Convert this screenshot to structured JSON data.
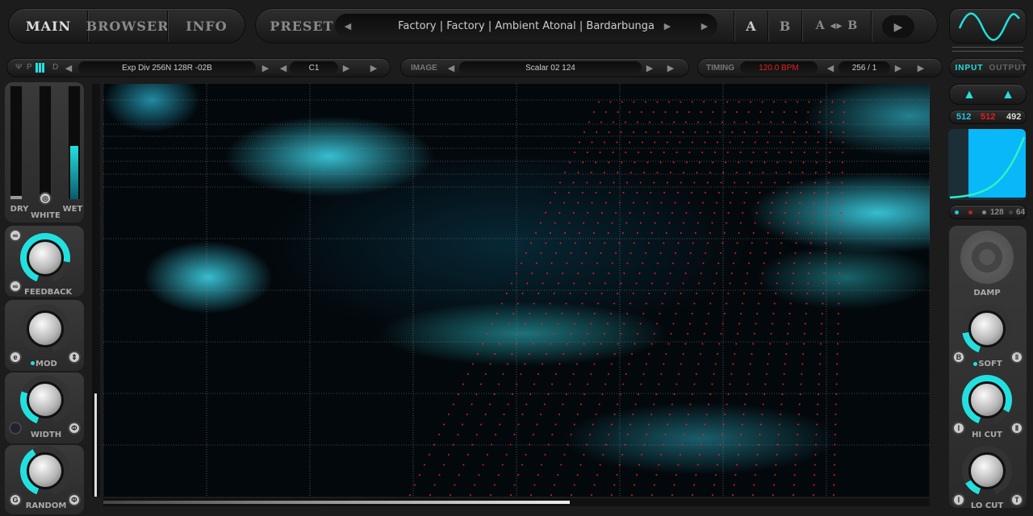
{
  "header": {
    "tabs": [
      "MAIN",
      "BROWSER",
      "INFO"
    ],
    "preset_label": "PRESET",
    "preset_value": "Factory | Factory | Ambient Atonal | Bardarbunga",
    "ab": [
      "A",
      "B",
      "A ◂▸ B"
    ]
  },
  "toolbar": {
    "mode_left": "P",
    "mode_right": "D",
    "synth_preset": "Exp Div 256N 128R -02B",
    "note": "C1",
    "image_label": "IMAGE",
    "image_value": "Scalar 02 124",
    "timing_label": "TIMING",
    "bpm": "120.0 BPM",
    "division": "256 / 1",
    "input_tab": "INPUT",
    "output_tab": "OUTPUT"
  },
  "left": {
    "dry": "DRY",
    "white": "WHITE",
    "wet": "WET",
    "feedback": "FEEDBACK",
    "mod": "MOD",
    "width": "WIDTH",
    "random": "RANDOM"
  },
  "right": {
    "counts": [
      "512",
      "512",
      "492"
    ],
    "legend_a": "128",
    "legend_b": "64",
    "damp": "DAMP",
    "soft": "SOFT",
    "hicut": "HI CUT",
    "locut": "LO CUT"
  },
  "colors": {
    "accent": "#23e0e0",
    "red": "#e02020"
  }
}
